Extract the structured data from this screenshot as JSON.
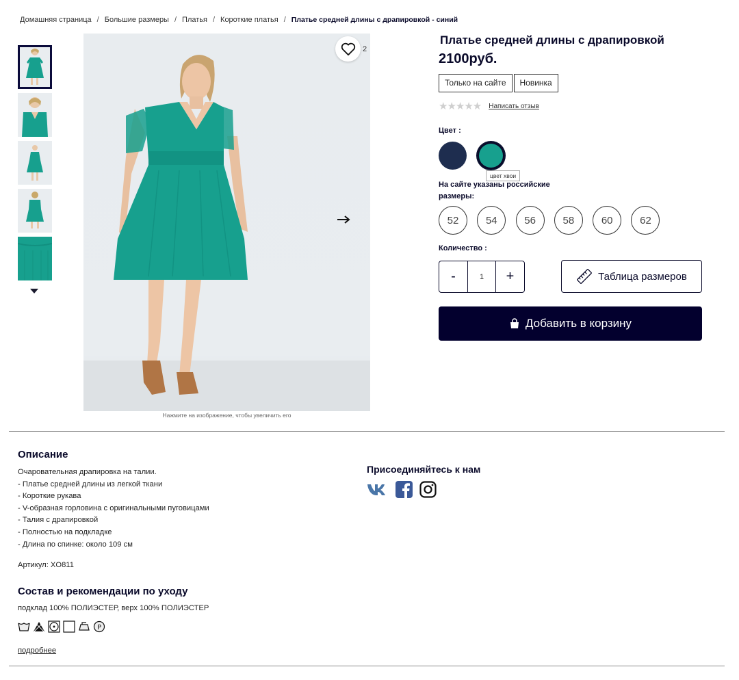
{
  "breadcrumb": {
    "items": [
      "Домашняя страница",
      "Большие размеры",
      "Платья",
      "Короткие платья"
    ],
    "current": "Платье средней длины с драпировкой - синий",
    "separator": "/"
  },
  "gallery": {
    "thumb_count": 5,
    "active_index": 0,
    "favorites_count": "2",
    "zoom_hint": "Нажмите на изображение, чтобы увеличить его"
  },
  "product": {
    "title": "Платье средней длины с драпировкой",
    "price": "2100руб.",
    "badges": [
      "Только на сайте",
      "Новинка"
    ],
    "rating_stars": "★★★★★",
    "review_link": "Написать отзыв",
    "color_label": "Цвет :",
    "colors": [
      {
        "name": "синий",
        "hex": "#1e2d4f"
      },
      {
        "name": "цвет хвои",
        "hex": "#17a08e",
        "selected": true
      }
    ],
    "color_tooltip": "цвет хвои",
    "size_note": "На сайте указаны российские размеры:",
    "sizes": [
      "52",
      "54",
      "56",
      "58",
      "60",
      "62"
    ],
    "quantity_label": "Количество :",
    "quantity_minus": "-",
    "quantity_value": "1",
    "quantity_plus": "+",
    "size_table_label": "Таблица размеров",
    "add_to_cart_label": "Добавить в корзину"
  },
  "description": {
    "title": "Описание",
    "lines": [
      "Очаровательная драпировка на талии.",
      "- Платье средней длины из легкой ткани",
      "- Короткие рукава",
      "- V-образная горловина с оригинальными пуговицами",
      "- Талия с драпировкой",
      "- Полностью на подкладке",
      "- Длина по спинке: около 109 см"
    ],
    "article": "Артикул: XO811"
  },
  "care": {
    "title": "Состав и рекомендации по уходу",
    "composition": "подклад 100% ПОЛИЭСТЕР, верх 100% ПОЛИЭСТЕР",
    "icons": [
      "wash-30-icon",
      "no-bleach-icon",
      "tumble-dry-icon",
      "line-dry-icon",
      "iron-low-icon",
      "dry-clean-p-icon"
    ],
    "more_link": "подробнее"
  },
  "social": {
    "title": "Присоединяйтесь к нам",
    "icons": [
      "vk-icon",
      "facebook-icon",
      "instagram-icon"
    ]
  },
  "colors": {
    "primary": "#03002e",
    "dress": "#17a08e",
    "navy": "#1e2d4f"
  }
}
